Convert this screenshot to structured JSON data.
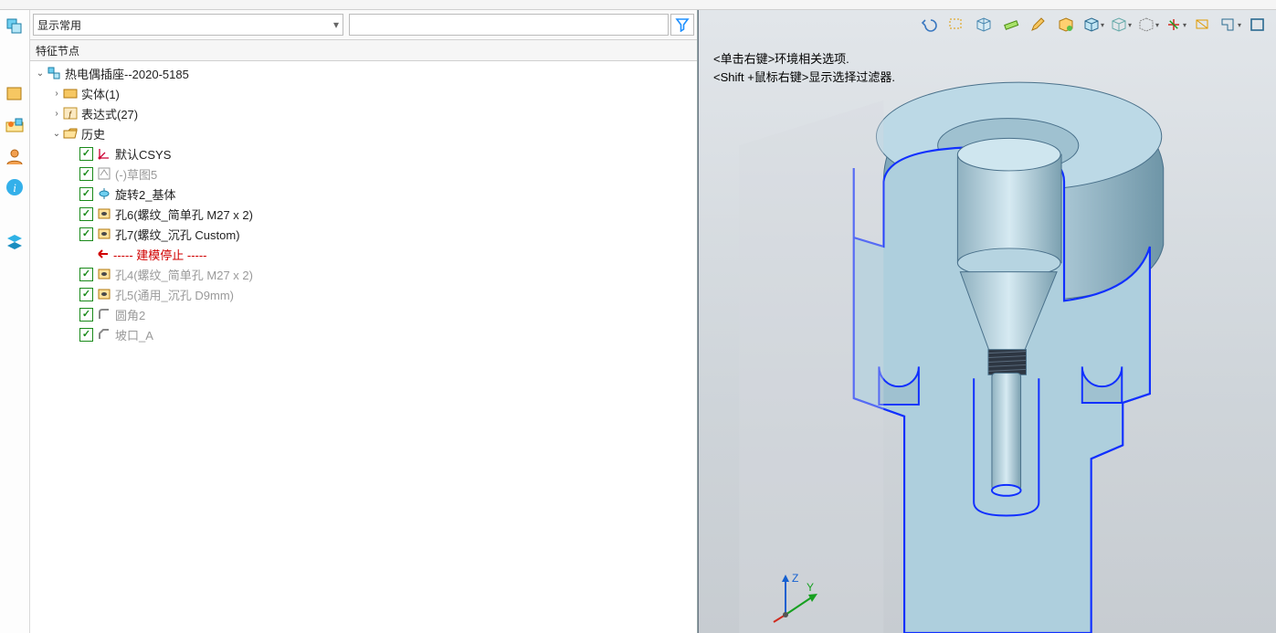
{
  "filter": {
    "mode_label": "显示常用",
    "search_value": ""
  },
  "tree": {
    "header": "特征节点",
    "root": {
      "label": "热电偶插座--2020-5185",
      "icon": "assembly"
    },
    "solids": {
      "label": "实体(1)",
      "icon": "solid"
    },
    "expressions": {
      "label": "表达式(27)",
      "icon": "expr"
    },
    "history": {
      "label": "历史",
      "icon": "folder",
      "items": [
        {
          "label": "默认CSYS",
          "icon": "csys",
          "dim": false
        },
        {
          "label": "(-)草图5",
          "icon": "sketch",
          "dim": true
        },
        {
          "label": "旋转2_基体",
          "icon": "revolve",
          "dim": false
        },
        {
          "label": "孔6(螺纹_简单孔 M27 x 2)",
          "icon": "hole",
          "dim": false
        },
        {
          "label": "孔7(螺纹_沉孔 Custom)",
          "icon": "hole",
          "dim": false
        },
        {
          "label": "----- 建模停止 -----",
          "icon": "stop",
          "stop": true,
          "nocb": true
        },
        {
          "label": "孔4(螺纹_简单孔 M27 x 2)",
          "icon": "hole",
          "dim": true
        },
        {
          "label": "孔5(通用_沉孔 D9mm)",
          "icon": "hole",
          "dim": true
        },
        {
          "label": "圆角2",
          "icon": "fillet",
          "dim": true
        },
        {
          "label": "坡口_A",
          "icon": "chamfer",
          "dim": true
        }
      ]
    }
  },
  "viewport": {
    "hint1": "<单击右键>环境相关选项.",
    "hint2": "<Shift +鼠标右键>显示选择过滤器.",
    "axis_labels": {
      "z": "Z",
      "y": "Y"
    }
  },
  "colors": {
    "funnel": "#1e90ff",
    "cube_accent": "#f0a000",
    "axis_z": "#1560d0",
    "axis_y": "#17a020",
    "axis_x": "#d02a1e",
    "model_fill": "#a6c9da",
    "model_edge": "#1130ff"
  }
}
